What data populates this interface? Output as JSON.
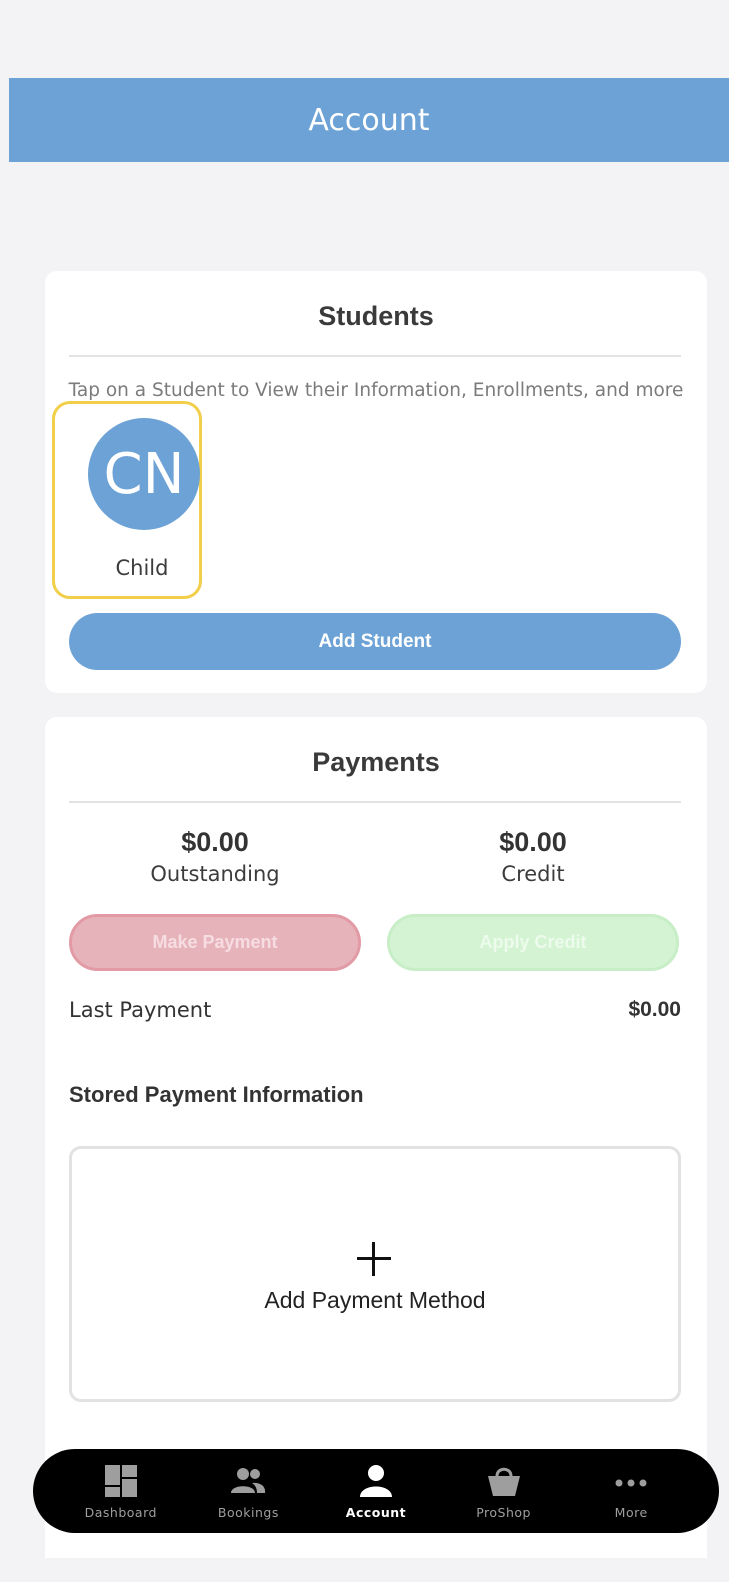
{
  "header": {
    "title": "Account"
  },
  "students": {
    "title": "Students",
    "hint": "Tap on a Student to View their Information, Enrollments, and more",
    "items": [
      {
        "initials": "CN",
        "name": "Child"
      }
    ],
    "add_button": "Add Student"
  },
  "payments": {
    "title": "Payments",
    "outstanding": {
      "value": "$0.00",
      "label": "Outstanding"
    },
    "credit": {
      "value": "$0.00",
      "label": "Credit"
    },
    "make_payment": "Make Payment",
    "apply_credit": "Apply Credit",
    "last_payment": {
      "label": "Last Payment",
      "value": "$0.00"
    },
    "stored_title": "Stored Payment Information",
    "add_method": "Add Payment Method"
  },
  "tabs": [
    {
      "label": "Dashboard",
      "icon": "dashboard-icon"
    },
    {
      "label": "Bookings",
      "icon": "people-icon"
    },
    {
      "label": "Account",
      "icon": "person-icon",
      "active": true
    },
    {
      "label": "ProShop",
      "icon": "basket-icon"
    },
    {
      "label": "More",
      "icon": "more-icon"
    }
  ],
  "colors": {
    "accent": "#6ca2d5",
    "selection": "#f2cf4a",
    "make_payment_bg": "#e7b3bb",
    "apply_credit_bg": "#d4f3d3"
  }
}
